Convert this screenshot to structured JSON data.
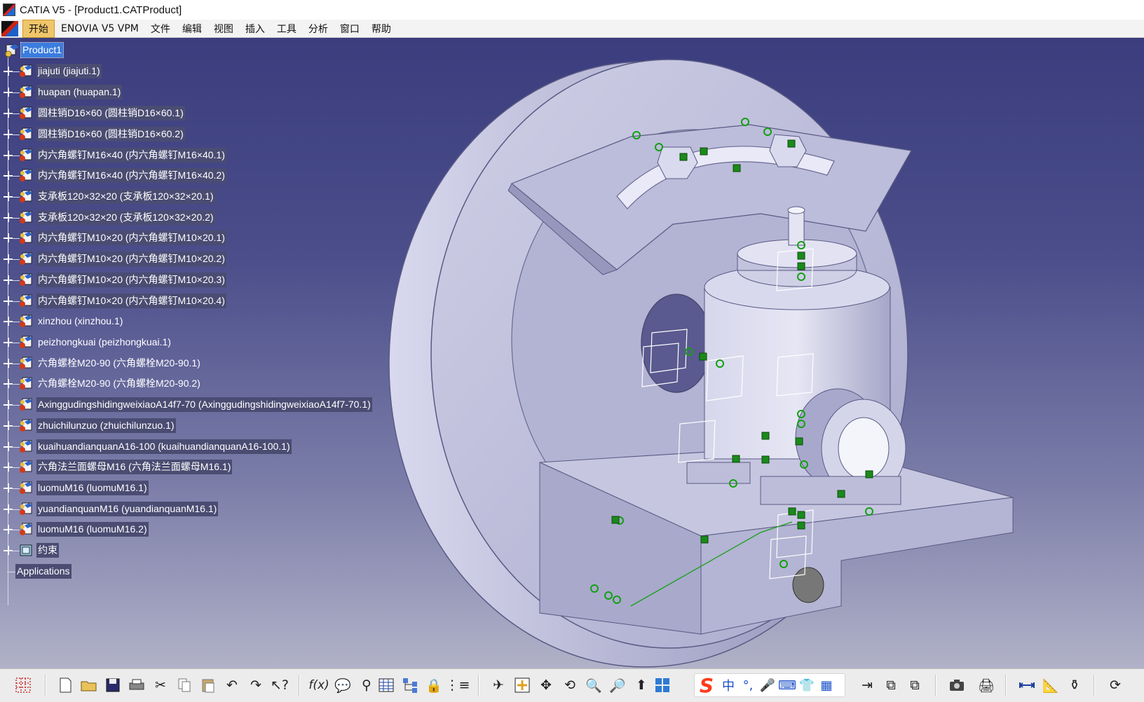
{
  "window": {
    "title": "CATIA V5 - [Product1.CATProduct]"
  },
  "menu": {
    "items": [
      "开始",
      "ENOVIA V5 VPM",
      "文件",
      "编辑",
      "视图",
      "插入",
      "工具",
      "分析",
      "窗口",
      "帮助"
    ]
  },
  "tree": {
    "root": "Product1",
    "nodes": [
      "jiajuti (jiajuti.1)",
      "huapan (huapan.1)",
      "圆柱销D16×60 (圆柱销D16×60.1)",
      "圆柱销D16×60 (圆柱销D16×60.2)",
      "内六角螺钉M16×40 (内六角螺钉M16×40.1)",
      "内六角螺钉M16×40 (内六角螺钉M16×40.2)",
      "支承板120×32×20 (支承板120×32×20.1)",
      "支承板120×32×20 (支承板120×32×20.2)",
      "内六角螺钉M10×20 (内六角螺钉M10×20.1)",
      "内六角螺钉M10×20 (内六角螺钉M10×20.2)",
      "内六角螺钉M10×20 (内六角螺钉M10×20.3)",
      "内六角螺钉M10×20 (内六角螺钉M10×20.4)",
      "xinzhou (xinzhou.1)",
      "peizhongkuai (peizhongkuai.1)",
      "六角螺栓M20-90 (六角螺栓M20-90.1)",
      "六角螺栓M20-90 (六角螺栓M20-90.2)",
      "AxinggudingshidingweixiaoA14f7-70 (AxinggudingshidingweixiaoA14f7-70.1)",
      "zhuichilunzuo (zhuichilunzuo.1)",
      "kuaihuandianquanA16-100 (kuaihuandianquanA16-100.1)",
      "六角法兰面螺母M16 (六角法兰面螺母M16.1)",
      "luomuM16 (luomuM16.1)",
      "yuandianquanM16 (yuandianquanM16.1)",
      "luomuM16 (luomuM16.2)"
    ],
    "constraints": "约束",
    "applications": "Applications"
  },
  "ime": {
    "logo": "S",
    "mode": "中",
    "punct": "°,",
    "items": [
      "mic-icon",
      "keyboard-icon",
      "shirt-icon",
      "apps-icon"
    ]
  },
  "colors": {
    "bg_top": "#3b3d7e",
    "bg_bottom": "#b1b2c8",
    "part": "#c9c9e2",
    "part_dark": "#9a9ac0",
    "accent_green": "#18a018",
    "root_highlight": "#3a7cdf"
  }
}
